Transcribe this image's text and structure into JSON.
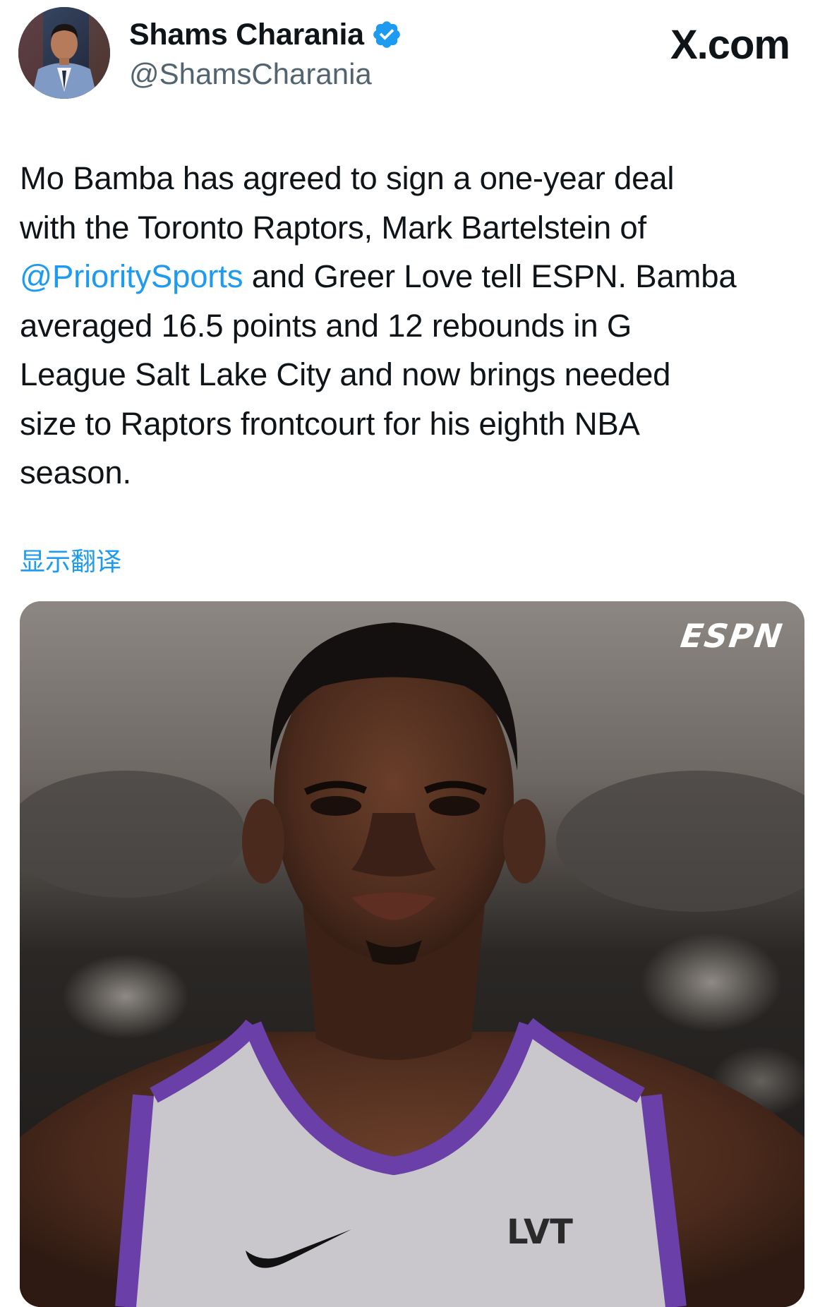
{
  "tweet": {
    "author": {
      "name": "Shams Charania",
      "handle": "@ShamsCharania",
      "verified": true,
      "verified_badge_color": "#1d9bf0"
    },
    "site_mark": "X.com",
    "text_segments": {
      "before_mention": "Mo Bamba has agreed to sign a one-year deal\nwith the Toronto Raptors, Mark Bartelstein of\n",
      "mention": "@PrioritySports",
      "after_mention": " and Greer Love tell ESPN. Bamba\naveraged 16.5 points and 12 rebounds in G\nLeague Salt Lake City and now brings needed\nsize to Raptors frontcourt for his eighth NBA\nseason."
    },
    "translate_label": "显示翻译",
    "media": {
      "watermark": "ESPN",
      "jersey_text": "LVT"
    },
    "colors": {
      "text": "#0f1419",
      "secondary_text": "#536471",
      "link": "#1d9bf0",
      "jersey_trim": "#6a3fa8"
    }
  }
}
